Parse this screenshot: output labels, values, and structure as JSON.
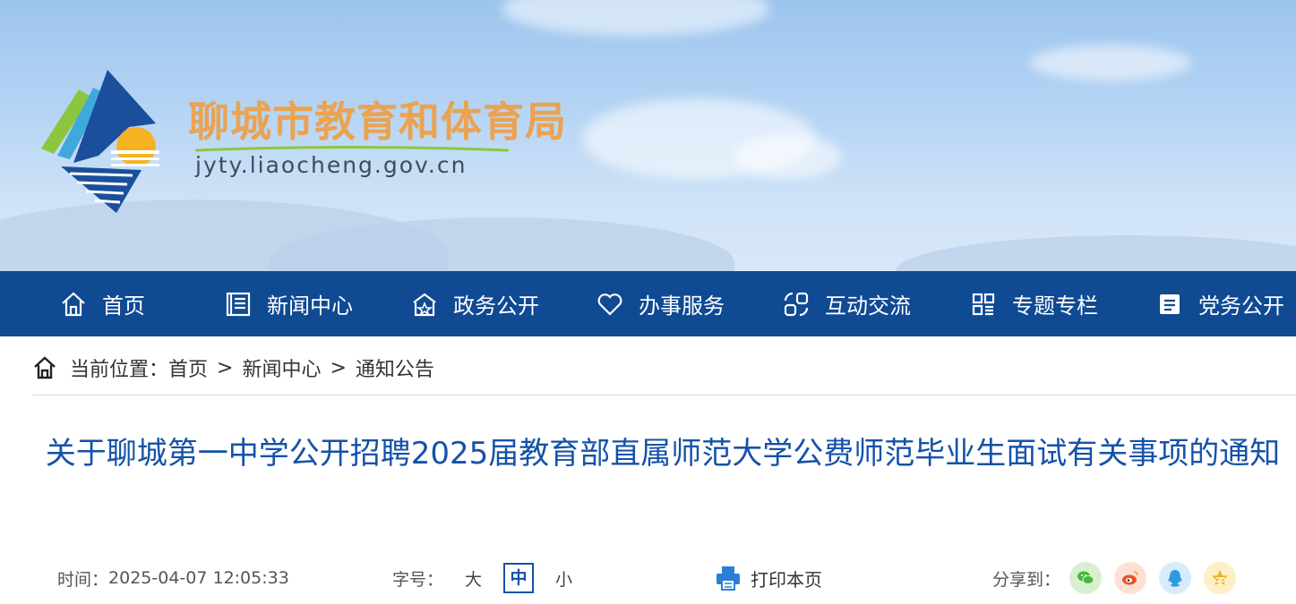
{
  "header": {
    "site_title": "聊城市教育和体育局",
    "site_url": "jyty.liaocheng.gov.cn"
  },
  "colors": {
    "nav_bg": "#0f4a93",
    "title_blue": "#1552a8",
    "title_orange": "#e9a352"
  },
  "nav": {
    "items": [
      {
        "label": "首页",
        "icon": "home-icon"
      },
      {
        "label": "新闻中心",
        "icon": "news-icon"
      },
      {
        "label": "政务公开",
        "icon": "gov-building-icon"
      },
      {
        "label": "办事服务",
        "icon": "heart-icon"
      },
      {
        "label": "互动交流",
        "icon": "interaction-icon"
      },
      {
        "label": "专题专栏",
        "icon": "grid-icon"
      },
      {
        "label": "党务公开",
        "icon": "party-icon"
      }
    ]
  },
  "breadcrumb": {
    "prefix": "当前位置：",
    "items": [
      "首页",
      "新闻中心",
      "通知公告"
    ],
    "separator": ">"
  },
  "article": {
    "title": "关于聊城第一中学公开招聘2025届教育部直属师范大学公费师范毕业生面试有关事项的通知",
    "time_label": "时间：",
    "time_value": "2025-04-07 12:05:33",
    "font_size_label": "字号：",
    "font_sizes": [
      "大",
      "中",
      "小"
    ],
    "print_label": "打印本页",
    "share_label": "分享到："
  },
  "share": {
    "targets": [
      "wechat-icon",
      "weibo-icon",
      "qq-icon",
      "qzone-icon"
    ]
  }
}
